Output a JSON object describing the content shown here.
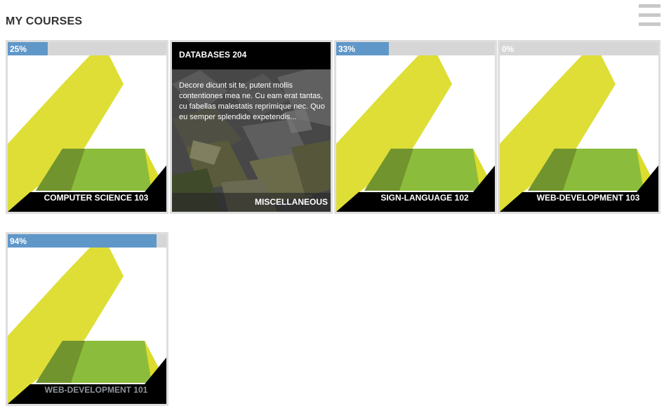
{
  "header": {
    "title": "MY COURSES",
    "menu_icon": "hamburger-menu-icon"
  },
  "colors": {
    "progress_fill": "#5a93c8",
    "progress_track": "#d6d6d6",
    "logo_yellow": "#dcdc2c",
    "logo_green": "#8cbc3c",
    "card_border": "#dedede",
    "banner": "#000000"
  },
  "courses": [
    {
      "title": "COMPUTER SCIENCE 103",
      "progress_label": "25%",
      "progress": 0.25
    },
    {
      "title": "DATABASES 204",
      "description": "Decore dicunt sit te, putent mollis contentiones mea ne. Cu eam erat tantas, cu fabellas malestatis reprimique nec. Quo eu semper splendide expetendis...",
      "category": "MISCELLANEOUS"
    },
    {
      "title": "SIGN-LANGUAGE 102",
      "progress_label": "33%",
      "progress": 0.33
    },
    {
      "title": "WEB-DEVELOPMENT 103",
      "progress_label": "0%",
      "progress": 0.0
    },
    {
      "title": "WEB-DEVELOPMENT 101",
      "progress_label": "94%",
      "progress": 0.94
    }
  ]
}
